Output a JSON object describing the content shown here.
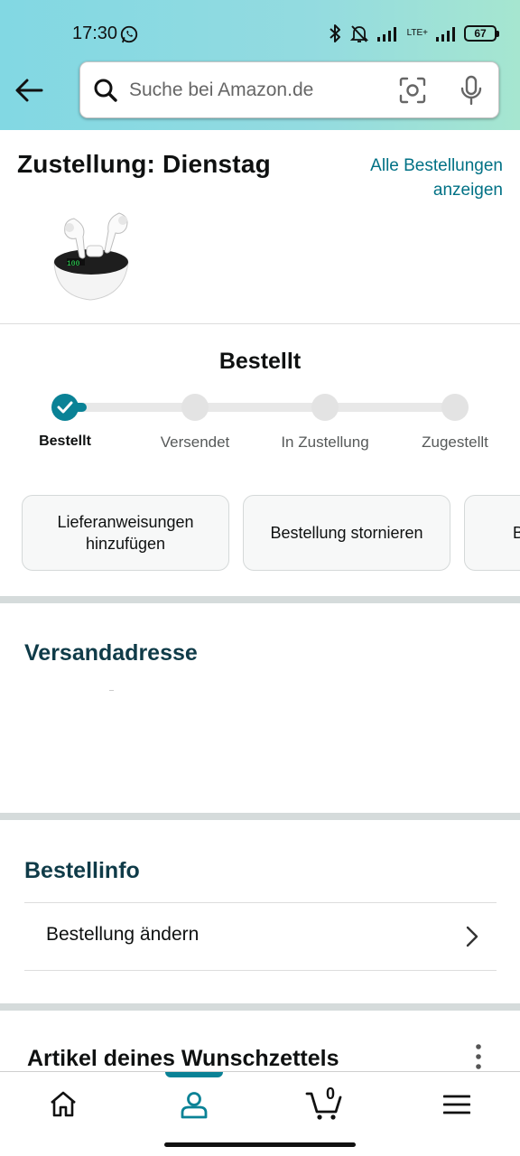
{
  "status_bar": {
    "time": "17:30",
    "network": "LTE+",
    "battery": "67",
    "icons": [
      "whatsapp-icon",
      "bluetooth-icon",
      "bell-muted-icon",
      "signal-icon",
      "signal-icon",
      "battery-icon"
    ]
  },
  "header": {
    "search_placeholder": "Suche bei Amazon.de",
    "icons": [
      "back-arrow-icon",
      "search-icon",
      "camera-icon",
      "mic-icon"
    ]
  },
  "delivery": {
    "title": "Zustellung: Dienstag",
    "all_orders_line1": "Alle Bestellungen",
    "all_orders_line2": "anzeigen"
  },
  "progress": {
    "title": "Bestellt",
    "current_step": 1,
    "steps": [
      "Bestellt",
      "Versendet",
      "In Zustellung",
      "Zugestellt"
    ]
  },
  "actions": {
    "buttons": [
      {
        "line1": "Lieferanweisungen",
        "line2": "hinzufügen"
      },
      {
        "line1": "Bestellung stornieren",
        "line2": ""
      },
      {
        "line1": "B",
        "line2": ""
      }
    ]
  },
  "address": {
    "title": "Versandadresse"
  },
  "order_info": {
    "title": "Bestellinfo",
    "edit_label": "Bestellung ändern"
  },
  "wishlist": {
    "title": "Artikel deines Wunschzettels"
  },
  "bottom_nav": {
    "items": [
      "home-icon",
      "account-icon",
      "cart-icon",
      "menu-icon"
    ],
    "active_item": "account-icon",
    "cart_count": "0"
  },
  "colors": {
    "header_gradient_start": "#82d8e3",
    "header_gradient_end": "#a6e6d0",
    "accent": "#0a8296",
    "link": "#007185",
    "heading_dark": "#0F3B48"
  }
}
